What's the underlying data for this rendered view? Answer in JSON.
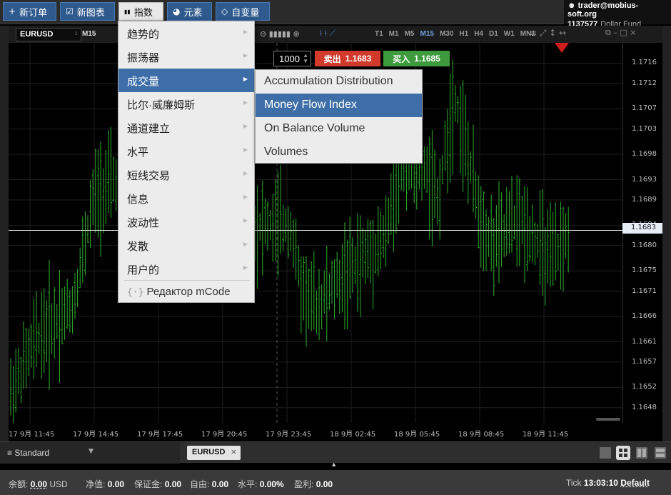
{
  "toolbar": {
    "new_order": "新订单",
    "new_chart": "新图表",
    "indicators": "指数",
    "elements": "元素",
    "variables": "自变量",
    "icon_plus": "+",
    "icon_chart": "☑",
    "icon_indicators": "▮▮",
    "icon_elements": "◕",
    "icon_variables": "◇"
  },
  "account": {
    "user": "trader@mobius-soft.org",
    "id": "1137577",
    "fund": "Dollar Fund"
  },
  "chart_toolbar": {
    "symbol": "EURUSD",
    "timeframe_current": "M15",
    "zoom_controls": "⊖ ▮▮▮▮▮ ⊕",
    "tool_icons": "⟊ ⟊ ⟋",
    "timeframes": [
      "T1",
      "M1",
      "M5",
      "M15",
      "M30",
      "H1",
      "H4",
      "D1",
      "W1",
      "MN1"
    ],
    "selected_timeframe": "M15",
    "drawing_icons": "≡ ⤢ ↕ ↔",
    "window_icons": "⧉ – □ ×"
  },
  "trade": {
    "quantity": "1000",
    "sell_label": "卖出",
    "sell_price": "1.1683",
    "buy_label": "买入",
    "buy_price": "1.1685"
  },
  "indicator_menu": {
    "items": [
      {
        "label": "趋势的"
      },
      {
        "label": "振荡器"
      },
      {
        "label": "成交量",
        "selected": true
      },
      {
        "label": "比尔·威廉姆斯"
      },
      {
        "label": "通道建立"
      },
      {
        "label": "水平"
      },
      {
        "label": "短线交易"
      },
      {
        "label": "信息"
      },
      {
        "label": "波动性"
      },
      {
        "label": "发散"
      },
      {
        "label": "用户的"
      }
    ],
    "mcode_label": "Редактор mCode",
    "mcode_icon": "{·}"
  },
  "volume_submenu": {
    "items": [
      {
        "label": "Accumulation Distribution"
      },
      {
        "label": "Money Flow Index",
        "selected": true
      },
      {
        "label": "On Balance Volume"
      },
      {
        "label": "Volumes"
      }
    ]
  },
  "chart_data": {
    "type": "ohlc",
    "symbol": "EURUSD",
    "timeframe": "M15",
    "y_ticks": [
      "1.1716",
      "1.1712",
      "1.1707",
      "1.1703",
      "1.1698",
      "1.1693",
      "1.1689",
      "1.1684",
      "1.1680",
      "1.1675",
      "1.1671",
      "1.1666",
      "1.1661",
      "1.1657",
      "1.1652",
      "1.1648"
    ],
    "x_ticks": [
      "17 9月 11:45",
      "17 9月 14:45",
      "17 9月 17:45",
      "17 9月 20:45",
      "17 9月 23:45",
      "18 9月 02:45",
      "18 9月 05:45",
      "18 9月 08:45",
      "18 9月 11:45"
    ],
    "ylim": [
      1.1645,
      1.172
    ],
    "current_price": "1.1683",
    "bar_color": "#2fae2f"
  },
  "bottom_tabs": {
    "layout": "Standard",
    "layout_icon": "≡",
    "chart_tab": "EURUSD",
    "close_icon": "×"
  },
  "status": {
    "balance_label": "余额:",
    "balance": "0.00",
    "currency": "USD",
    "equity_label": "净值:",
    "equity": "0.00",
    "margin_label": "保证金:",
    "margin": "0.00",
    "free_label": "自由:",
    "free": "0.00",
    "level_label": "水平:",
    "level": "0.00%",
    "profit_label": "盈利:",
    "profit": "0.00",
    "tick_label": "Tick",
    "time": "13:03:10",
    "mode": "Default"
  }
}
